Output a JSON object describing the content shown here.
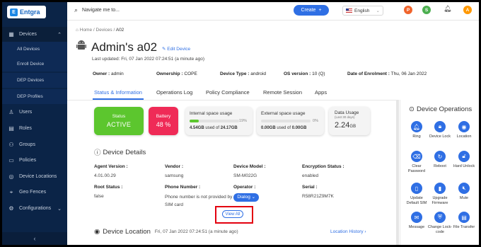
{
  "brand": {
    "logo_mark": "E",
    "name": "Entgra"
  },
  "sidebar": {
    "items": [
      {
        "label": "Devices",
        "icon": "grid-icon"
      },
      {
        "label": "All Devices"
      },
      {
        "label": "Enroll Device"
      },
      {
        "label": "DEP Devices"
      },
      {
        "label": "DEP Profiles"
      },
      {
        "label": "Users",
        "icon": "user-icon"
      },
      {
        "label": "Roles",
        "icon": "roles-icon"
      },
      {
        "label": "Groups",
        "icon": "groups-icon"
      },
      {
        "label": "Policies",
        "icon": "policy-icon"
      },
      {
        "label": "Device Locations",
        "icon": "location-icon"
      },
      {
        "label": "Geo Fences",
        "icon": "geofence-icon"
      },
      {
        "label": "Configurations",
        "icon": "gear-icon"
      }
    ],
    "collapse_glyph": "‹"
  },
  "topbar": {
    "search_placeholder": "Navigate me to...",
    "create_label": "Create",
    "create_glyph": "+",
    "language": "English",
    "avatars": [
      {
        "letter": "P",
        "color": "#f0642c"
      },
      {
        "letter": "S",
        "color": "#4caf50"
      },
      {
        "letter": "A",
        "color": "#ff9800"
      }
    ]
  },
  "breadcrumb": {
    "home": "Home",
    "sep": "/",
    "devices": "Devices",
    "current": "A02"
  },
  "device": {
    "title": "Admin's a02",
    "edit_label": "Edit Device",
    "last_updated": "Last updated: Fri, 07 Jan 2022 07:24:51 (a minute ago)",
    "owner_label": "Owner :",
    "owner": "admin",
    "ownership_label": "Ownership :",
    "ownership": "COPE",
    "type_label": "Device Type :",
    "type": "android",
    "os_label": "OS version :",
    "os": "10 (Q)",
    "enrol_label": "Date of Enrolment :",
    "enrol": "Thu, 06 Jan 2022"
  },
  "tabs": [
    "Status & Information",
    "Operations Log",
    "Policy Compliance",
    "Remote Session",
    "Apps"
  ],
  "cards": {
    "status_title": "Status",
    "status_value": "ACTIVE",
    "battery_title": "Battery",
    "battery_value": "48 %",
    "internal_title": "Internal space usage",
    "internal_pct": "19%",
    "internal_fill": 0.19,
    "internal_used": "4.54GB",
    "internal_of": "used of",
    "internal_total": "24.17GB",
    "external_title": "External space usage",
    "external_pct": "0%",
    "external_fill": 0,
    "external_used": "0.00GB",
    "external_of": "used of",
    "external_total": "0.00GB",
    "data_title": "Data Usage",
    "data_sub": "(Last 30 days)",
    "data_value": "2.24",
    "data_unit": "GB"
  },
  "details": {
    "title": "Device Details",
    "agent_label": "Agent Version :",
    "agent": "4.01.00.29",
    "vendor_label": "Vendor :",
    "vendor": "samsung",
    "model_label": "Device Model :",
    "model": "SM-M022G",
    "enc_label": "Encryption Status :",
    "enc": "enabled",
    "root_label": "Root Status :",
    "root": "false",
    "phone_label": "Phone Number :",
    "phone_text": "Phone number is not provided by",
    "phone_chip": "Dialog",
    "phone_text2": "SIM card",
    "operator_label": "Operator :",
    "serial_label": "Serial :",
    "serial": "R58R21Z9M7K",
    "view_all": "View All"
  },
  "location": {
    "title": "Device Location",
    "timestamp": "Fri, 07 Jan 2022 07:24:51 (a minute ago)",
    "history": "Location History"
  },
  "operations": {
    "title": "Device Operations",
    "items": [
      {
        "label": "Ring",
        "icon": "ring-icon"
      },
      {
        "label": "Device Lock",
        "icon": "lock-icon"
      },
      {
        "label": "Location",
        "icon": "location-icon"
      },
      {
        "label": "Clear Password",
        "icon": "clear-password-icon"
      },
      {
        "label": "Reboot",
        "icon": "reboot-icon"
      },
      {
        "label": "Hard Unlock",
        "icon": "unlock-icon"
      },
      {
        "label": "Update Default SIM",
        "icon": "sim-icon"
      },
      {
        "label": "Upgrade Firmware",
        "icon": "firmware-icon"
      },
      {
        "label": "Mute",
        "icon": "mute-icon"
      },
      {
        "label": "Message",
        "icon": "message-icon"
      },
      {
        "label": "Change Lock-code",
        "icon": "lock-code-icon"
      },
      {
        "label": "File Transfer",
        "icon": "file-transfer-icon"
      }
    ]
  },
  "colors": {
    "brand_blue": "#2f6fe4",
    "status_green": "#5cc62e",
    "battery_red": "#ef2b57",
    "sidebar": "#0b2447",
    "highlight_red": "#e3000f"
  }
}
